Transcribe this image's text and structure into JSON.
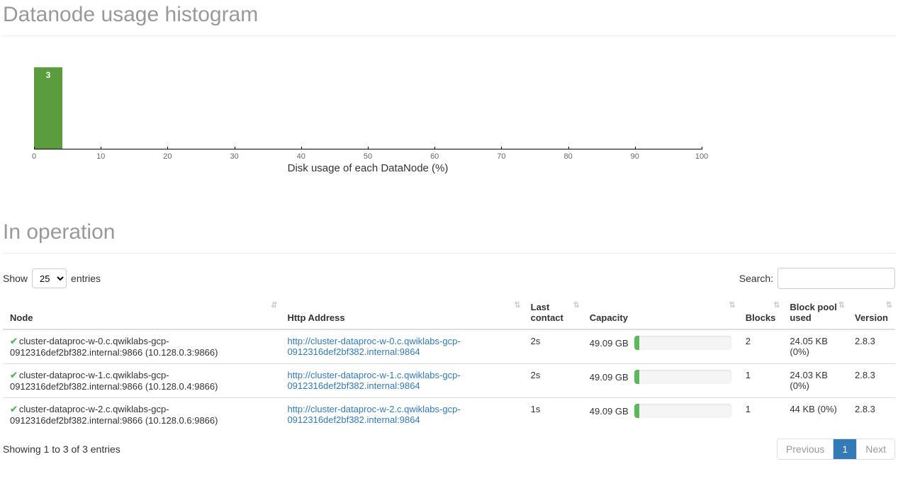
{
  "histogram": {
    "title": "Datanode usage histogram",
    "xlabel": "Disk usage of each DataNode (%)",
    "ticks": [
      0,
      10,
      20,
      30,
      40,
      50,
      60,
      70,
      80,
      90,
      100
    ],
    "bar_value": "3"
  },
  "chart_data": {
    "type": "bar",
    "title": "Datanode usage histogram",
    "xlabel": "Disk usage of each DataNode (%)",
    "ylabel": "",
    "xlim": [
      0,
      100
    ],
    "categories": [
      "0-10",
      "10-20",
      "20-30",
      "30-40",
      "40-50",
      "50-60",
      "60-70",
      "70-80",
      "80-90",
      "90-100"
    ],
    "values": [
      3,
      0,
      0,
      0,
      0,
      0,
      0,
      0,
      0,
      0
    ]
  },
  "operation": {
    "title": "In operation",
    "show_label_pre": "Show",
    "show_label_post": "entries",
    "show_value": "25",
    "search_label": "Search:",
    "columns": {
      "node": "Node",
      "http": "Http Address",
      "last": "Last contact",
      "capacity": "Capacity",
      "blocks": "Blocks",
      "pool": "Block pool used",
      "version": "Version"
    },
    "rows": [
      {
        "node": "cluster-dataproc-w-0.c.qwiklabs-gcp-0912316def2bf382.internal:9866 (10.128.0.3:9866)",
        "http": "http://cluster-dataproc-w-0.c.qwiklabs-gcp-0912316def2bf382.internal:9864",
        "last": "2s",
        "capacity": "49.09 GB",
        "blocks": "2",
        "pool": "24.05 KB (0%)",
        "version": "2.8.3"
      },
      {
        "node": "cluster-dataproc-w-1.c.qwiklabs-gcp-0912316def2bf382.internal:9866 (10.128.0.4:9866)",
        "http": "http://cluster-dataproc-w-1.c.qwiklabs-gcp-0912316def2bf382.internal:9864",
        "last": "2s",
        "capacity": "49.09 GB",
        "blocks": "1",
        "pool": "24.03 KB (0%)",
        "version": "2.8.3"
      },
      {
        "node": "cluster-dataproc-w-2.c.qwiklabs-gcp-0912316def2bf382.internal:9866 (10.128.0.6:9866)",
        "http": "http://cluster-dataproc-w-2.c.qwiklabs-gcp-0912316def2bf382.internal:9864",
        "last": "1s",
        "capacity": "49.09 GB",
        "blocks": "1",
        "pool": "44 KB (0%)",
        "version": "2.8.3"
      }
    ],
    "info": "Showing 1 to 3 of 3 entries",
    "pagination": {
      "prev": "Previous",
      "page": "1",
      "next": "Next"
    }
  }
}
